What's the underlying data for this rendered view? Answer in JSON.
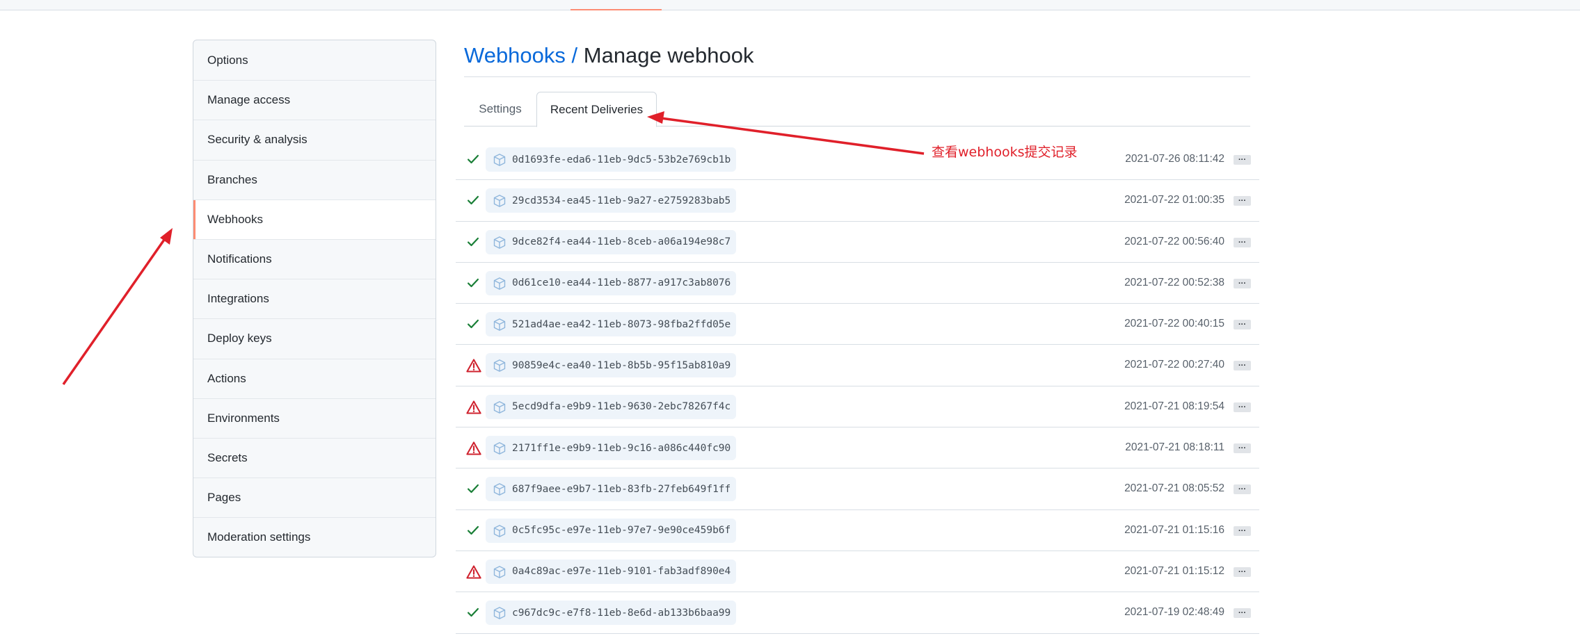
{
  "sidebar": {
    "items": [
      {
        "label": "Options",
        "active": false
      },
      {
        "label": "Manage access",
        "active": false
      },
      {
        "label": "Security & analysis",
        "active": false
      },
      {
        "label": "Branches",
        "active": false
      },
      {
        "label": "Webhooks",
        "active": true
      },
      {
        "label": "Notifications",
        "active": false
      },
      {
        "label": "Integrations",
        "active": false
      },
      {
        "label": "Deploy keys",
        "active": false
      },
      {
        "label": "Actions",
        "active": false
      },
      {
        "label": "Environments",
        "active": false
      },
      {
        "label": "Secrets",
        "active": false
      },
      {
        "label": "Pages",
        "active": false
      },
      {
        "label": "Moderation settings",
        "active": false
      }
    ]
  },
  "header": {
    "crumb": "Webhooks",
    "separator": " / ",
    "current": "Manage webhook"
  },
  "tabs": [
    {
      "label": "Settings",
      "selected": false
    },
    {
      "label": "Recent Deliveries",
      "selected": true
    }
  ],
  "deliveries": [
    {
      "status": "success",
      "guid": "0d1693fe-eda6-11eb-9dc5-53b2e769cb1b",
      "timestamp": "2021-07-26 08:11:42"
    },
    {
      "status": "success",
      "guid": "29cd3534-ea45-11eb-9a27-e2759283bab5",
      "timestamp": "2021-07-22 01:00:35"
    },
    {
      "status": "success",
      "guid": "9dce82f4-ea44-11eb-8ceb-a06a194e98c7",
      "timestamp": "2021-07-22 00:56:40"
    },
    {
      "status": "success",
      "guid": "0d61ce10-ea44-11eb-8877-a917c3ab8076",
      "timestamp": "2021-07-22 00:52:38"
    },
    {
      "status": "success",
      "guid": "521ad4ae-ea42-11eb-8073-98fba2ffd05e",
      "timestamp": "2021-07-22 00:40:15"
    },
    {
      "status": "failure",
      "guid": "90859e4c-ea40-11eb-8b5b-95f15ab810a9",
      "timestamp": "2021-07-22 00:27:40"
    },
    {
      "status": "failure",
      "guid": "5ecd9dfa-e9b9-11eb-9630-2ebc78267f4c",
      "timestamp": "2021-07-21 08:19:54"
    },
    {
      "status": "failure",
      "guid": "2171ff1e-e9b9-11eb-9c16-a086c440fc90",
      "timestamp": "2021-07-21 08:18:11"
    },
    {
      "status": "success",
      "guid": "687f9aee-e9b7-11eb-83fb-27feb649f1ff",
      "timestamp": "2021-07-21 08:05:52"
    },
    {
      "status": "success",
      "guid": "0c5fc95c-e97e-11eb-97e7-9e90ce459b6f",
      "timestamp": "2021-07-21 01:15:16"
    },
    {
      "status": "failure",
      "guid": "0a4c89ac-e97e-11eb-9101-fab3adf890e4",
      "timestamp": "2021-07-21 01:15:12"
    },
    {
      "status": "success",
      "guid": "c967dc9c-e7f8-11eb-8e6d-ab133b6baa99",
      "timestamp": "2021-07-19 02:48:49"
    }
  ],
  "more_label": "···",
  "annotation": {
    "text": "查看webhooks提交记录",
    "color": "#e0202a"
  },
  "colors": {
    "success": "#1a7f37",
    "failure": "#cf222e",
    "link": "#0969da",
    "active_indicator": "#fd8c73"
  },
  "icons": {
    "success": "check-icon",
    "failure": "alert-icon",
    "delivery": "package-icon",
    "more": "kebab-horizontal-icon"
  }
}
